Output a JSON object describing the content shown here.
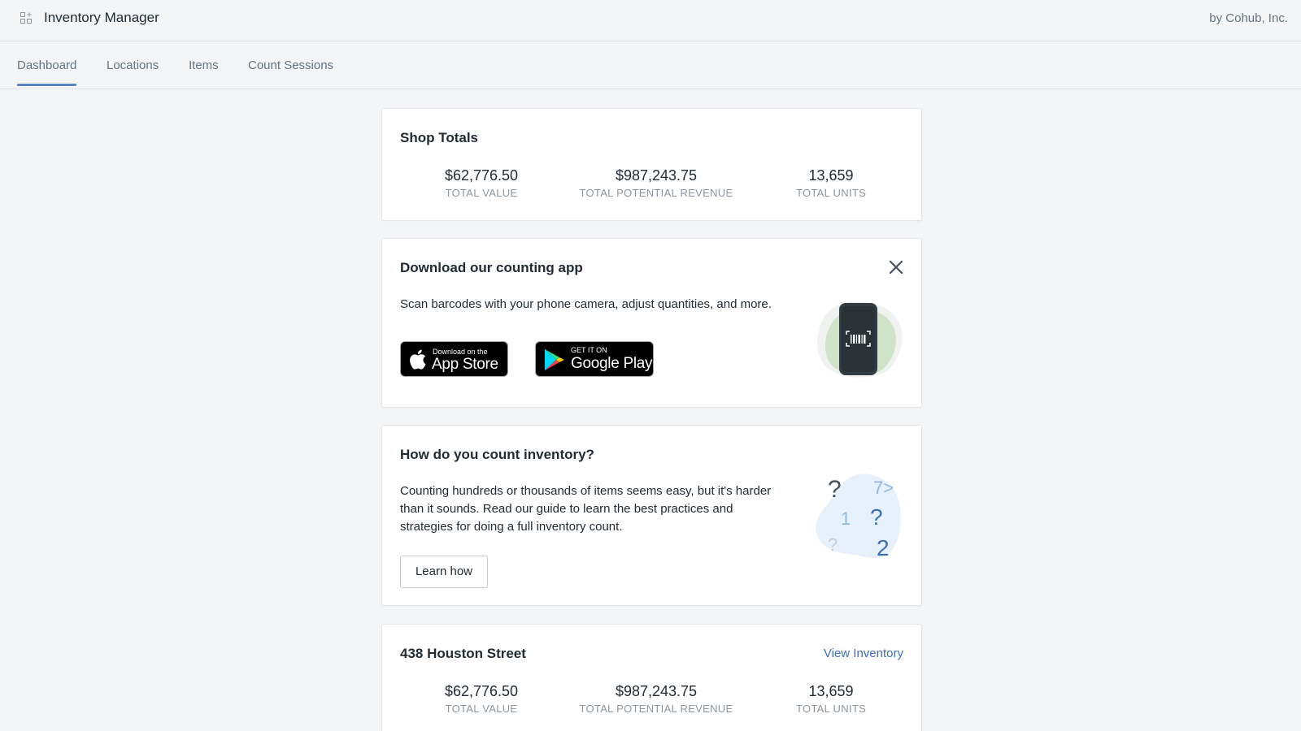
{
  "header": {
    "app_icon": "apps-grid-icon",
    "title": "Inventory Manager",
    "byline": "by Cohub, Inc."
  },
  "tabs": [
    {
      "label": "Dashboard",
      "active": true
    },
    {
      "label": "Locations",
      "active": false
    },
    {
      "label": "Items",
      "active": false
    },
    {
      "label": "Count Sessions",
      "active": false
    }
  ],
  "shop_totals": {
    "title": "Shop Totals",
    "stats": [
      {
        "value": "$62,776.50",
        "label": "TOTAL VALUE"
      },
      {
        "value": "$987,243.75",
        "label": "TOTAL POTENTIAL REVENUE"
      },
      {
        "value": "13,659",
        "label": "TOTAL UNITS"
      }
    ]
  },
  "download_app": {
    "title": "Download our counting app",
    "description": "Scan barcodes with your phone camera, adjust quantities, and more.",
    "close_icon": "close-icon",
    "app_store": {
      "small": "Download on the",
      "big": "App Store"
    },
    "google_play": {
      "small": "GET IT ON",
      "big": "Google Play"
    },
    "illustration": "phone-barcode-illustration"
  },
  "how_count": {
    "title": "How do you count inventory?",
    "description_lines": [
      "Counting hundreds or thousands of items seems easy, but it's harder",
      "than it sounds. Read our guide to learn the best practices and",
      "strategies for doing a full inventory count."
    ],
    "button": "Learn how",
    "illustration": "question-numbers-illustration"
  },
  "location": {
    "title": "438 Houston Street",
    "link": "View Inventory",
    "stats": [
      {
        "value": "$62,776.50",
        "label": "TOTAL VALUE"
      },
      {
        "value": "$987,243.75",
        "label": "TOTAL POTENTIAL REVENUE"
      },
      {
        "value": "13,659",
        "label": "TOTAL UNITS"
      }
    ]
  },
  "colors": {
    "accent": "#5c85c9",
    "link": "#3d6fb6",
    "background": "#f4f5f6"
  }
}
